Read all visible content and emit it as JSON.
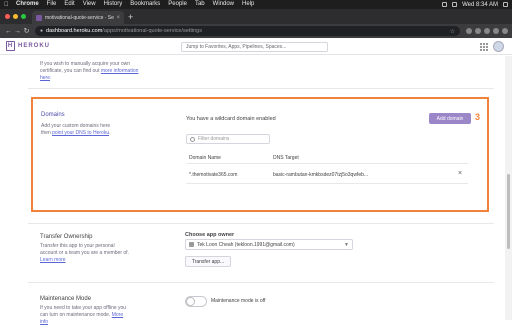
{
  "menubar": {
    "app": "Chrome",
    "items": [
      "File",
      "Edit",
      "View",
      "History",
      "Bookmarks",
      "People",
      "Tab",
      "Window",
      "Help"
    ],
    "clock": "Wed 8:34 AM"
  },
  "browser": {
    "tab_title": "motivational-quote-service · Se",
    "tab_close": "×",
    "new_tab": "+",
    "url_host": "dashboard.heroku.com",
    "url_path": "/apps/motivational-quote-service/settings"
  },
  "heroku": {
    "logo_mark": "H",
    "logo_text": "HEROKU",
    "jump_placeholder": "Jump to Favorites, Apps, Pipelines, Spaces..."
  },
  "previous_section": {
    "text_before": "If you wish to manually acquire your own certificate, you can find out ",
    "link": "more information here",
    "text_after": "."
  },
  "domains": {
    "title": "Domains",
    "desc_before": "Add your custom domains here then ",
    "desc_link": "point your DNS to Heroku",
    "desc_after": ".",
    "wildcard_notice": "You have a wildcard domain enabled",
    "add_button": "Add domain",
    "step_marker": "3",
    "filter_placeholder": "Filter domains",
    "columns": [
      "Domain Name",
      "DNS Target"
    ],
    "rows": [
      {
        "domain": "*.themotivate365.com",
        "target": "basic-rambutan-kmkbsdez07tzj5o3qwfeb..."
      }
    ],
    "delete_icon": "×"
  },
  "transfer": {
    "title": "Transfer Ownership",
    "desc_before": "Transfer this app to your personal account or a team you are a member of. ",
    "desc_link": "Learn more",
    "choose_label": "Choose app owner",
    "owner_value": "Tek Loon Cheah (tekloon.1991@gmail.com)",
    "button": "Transfer app..."
  },
  "maintenance": {
    "title": "Maintenance Mode",
    "desc_before": "If you need to take your app offline you can turn on maintenance mode. ",
    "desc_link": "More info",
    "status": "Maintenance mode is off",
    "enabled": false
  },
  "colors": {
    "highlight_border": "#f0823c",
    "heroku_purple": "#79589f",
    "add_button_bg": "#9b86c8"
  }
}
